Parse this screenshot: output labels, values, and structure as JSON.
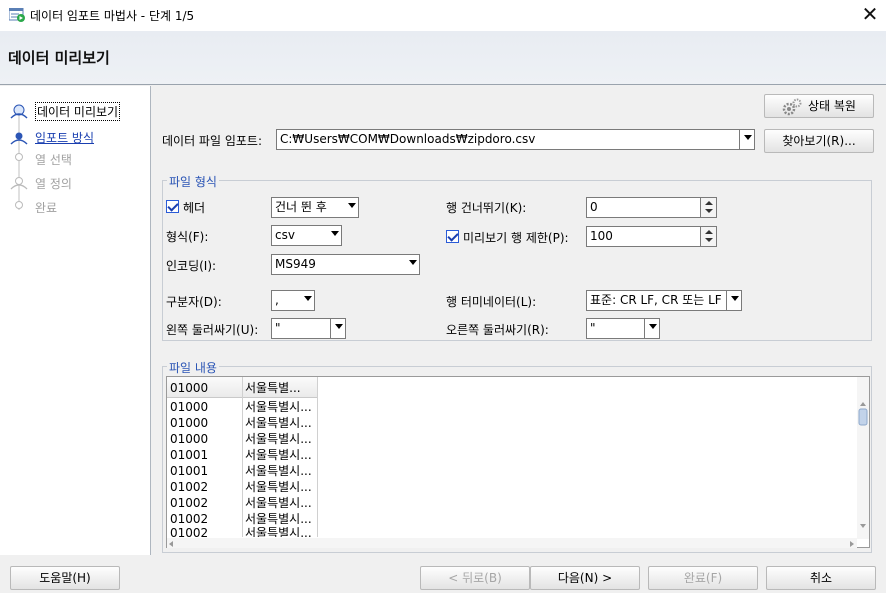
{
  "window": {
    "title": "데이터 임포트 마법사 - 단계 1/5",
    "close_glyph": "✕"
  },
  "header": {
    "title": "데이터 미리보기"
  },
  "steps": [
    {
      "label": "데이터 미리보기",
      "state": "current"
    },
    {
      "label": "임포트 방식",
      "state": "link"
    },
    {
      "label": "열 선택",
      "state": "disabled"
    },
    {
      "label": "열 정의",
      "state": "disabled"
    },
    {
      "label": "완료",
      "state": "disabled"
    }
  ],
  "top": {
    "restore_label": "상태 복원",
    "file_label": "데이터 파일 임포트:",
    "file_value": "C:₩Users₩COM₩Downloads₩zipdoro.csv",
    "browse_label": "찾아보기(R)..."
  },
  "format": {
    "group_title": "파일 형식",
    "header_label": "헤더",
    "header_checked": true,
    "header_combo": "건너 뛴 후",
    "skip_label": "행 건너뛰기(K):",
    "skip_value": "0",
    "format_label": "형식(F):",
    "format_value": "csv",
    "preview_limit_label": "미리보기 행 제한(P):",
    "preview_limit_checked": true,
    "preview_limit_value": "100",
    "encoding_label": "인코딩(I):",
    "encoding_value": "MS949",
    "delimiter_label": "구분자(D):",
    "delimiter_value": ",",
    "terminator_label": "행 터미네이터(L):",
    "terminator_value": "표준: CR LF, CR 또는 LF",
    "left_enclosure_label": "왼쪽 둘러싸기(U):",
    "left_enclosure_value": "\"",
    "right_enclosure_label": "오른쪽 둘러싸기(R):",
    "right_enclosure_value": "\""
  },
  "contents": {
    "group_title": "파일 내용",
    "headers": [
      "01000",
      "서울특별..."
    ],
    "rows": [
      [
        "01000",
        "서울특별시..."
      ],
      [
        "01000",
        "서울특별시..."
      ],
      [
        "01000",
        "서울특별시..."
      ],
      [
        "01001",
        "서울특별시..."
      ],
      [
        "01001",
        "서울특별시..."
      ],
      [
        "01002",
        "서울특별시..."
      ],
      [
        "01002",
        "서울특별시..."
      ],
      [
        "01002",
        "서울특별시..."
      ],
      [
        "01002",
        "서울특별시..."
      ]
    ]
  },
  "footer": {
    "help_label": "도움말(H)",
    "back_label": "< 뒤로(B)",
    "next_label": "다음(N) >",
    "finish_label": "완료(F)",
    "cancel_label": "취소"
  },
  "colors": {
    "accent": "#2b55b5",
    "link": "#1a3fb0",
    "disabled": "#a0a0a0"
  }
}
